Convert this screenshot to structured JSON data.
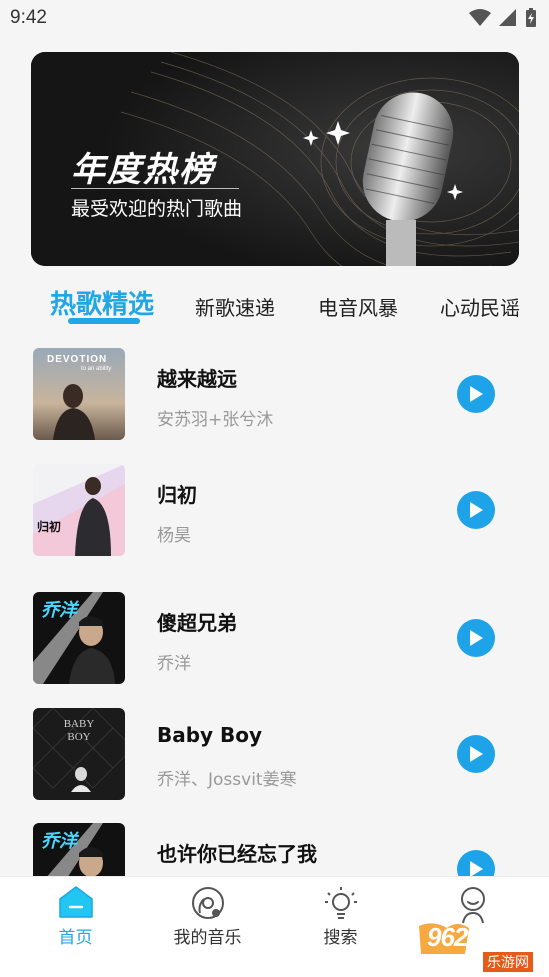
{
  "status_bar": {
    "time": "9:42"
  },
  "banner": {
    "title": "年度热榜",
    "subtitle": "最受欢迎的热门歌曲"
  },
  "tabs": [
    {
      "label": "热歌精选",
      "active": true
    },
    {
      "label": "新歌速递",
      "active": false
    },
    {
      "label": "电音风暴",
      "active": false
    },
    {
      "label": "心动民谣",
      "active": false
    }
  ],
  "songs": [
    {
      "title": "越来越远",
      "artist": "安苏羽+张兮沐",
      "cover_text": "DEVOTION",
      "cover_sub": "to an ability"
    },
    {
      "title": "归初",
      "artist": "杨昊",
      "cover_text": "归初"
    },
    {
      "title": "傻超兄弟",
      "artist": "乔洋",
      "cover_text": "乔洋"
    },
    {
      "title": "Baby Boy",
      "artist": "乔洋、Jossvit姜寒",
      "cover_text": "BABY BOY"
    },
    {
      "title": "也许你已经忘了我",
      "artist": "",
      "cover_text": "乔洋"
    }
  ],
  "bottom_nav": [
    {
      "label": "首页",
      "icon": "home-icon",
      "active": true
    },
    {
      "label": "我的音乐",
      "icon": "music-disc-icon",
      "active": false
    },
    {
      "label": "搜索",
      "icon": "lightbulb-search-icon",
      "active": false
    },
    {
      "label": "",
      "icon": "profile-icon",
      "active": false
    }
  ],
  "watermark": {
    "text": "962.NET",
    "sub": "乐游网"
  },
  "colors": {
    "accent": "#21a6e6",
    "play": "#1ea3e8"
  }
}
